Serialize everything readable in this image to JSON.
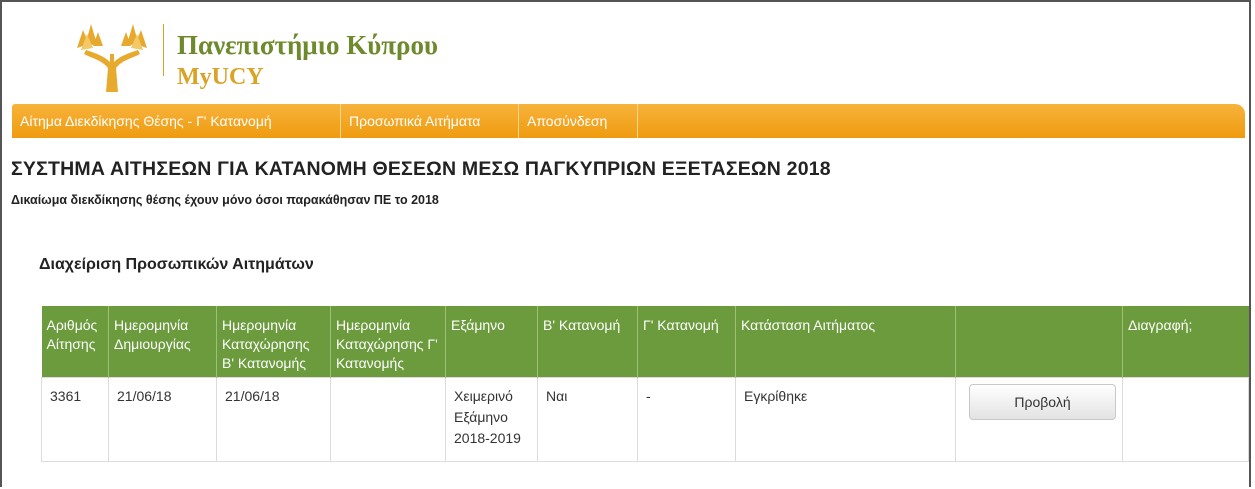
{
  "header": {
    "university_name": "Πανεπιστήμιο Κύπρου",
    "app_name": "MyUCY",
    "brand_colors": {
      "green": "#6f8a2c",
      "gold": "#d9a326"
    }
  },
  "nav": {
    "items": [
      {
        "label": "Αίτημα Διεκδίκησης Θέσης - Γ' Κατανομή"
      },
      {
        "label": "Προσωπικά Αιτήματα"
      },
      {
        "label": "Αποσύνδεση"
      }
    ],
    "color": "#f2a21c"
  },
  "page": {
    "title": "ΣΥΣΤΗΜΑ ΑΙΤΗΣΕΩΝ ΓΙΑ ΚΑΤΑΝΟΜΗ ΘΕΣΕΩΝ ΜΕΣΩ ΠΑΓΚΥΠΡΙΩΝ ΕΞΕΤΑΣΕΩΝ 2018",
    "subtitle": "Δικαίωμα διεκδίκησης θέσης έχουν μόνο όσοι παρακάθησαν ΠΕ το 2018",
    "section_title": "Διαχείριση Προσωπικών Αιτημάτων"
  },
  "table": {
    "header_color": "#6b9b3d",
    "columns": [
      "Αριθμός Αίτησης",
      "Ημερομηνία Δημιουργίας",
      "Ημερομηνία Καταχώρησης Β' Κατανομής",
      "Ημερομηνία Καταχώρησης Γ' Κατανομής",
      "Εξάμηνο",
      "Β' Κατανομή",
      "Γ' Κατανομή",
      "Κατάσταση Αιτήματος",
      "",
      "Διαγραφή;"
    ],
    "rows": [
      {
        "id": "3361",
        "created": "21/06/18",
        "b_registration": "21/06/18",
        "c_registration": "",
        "semester": "Χειμερινό Εξάμηνο 2018-2019",
        "b_allocation": "Ναι",
        "c_allocation": "-",
        "status": "Εγκρίθηκε",
        "action_label": "Προβολή",
        "delete": ""
      }
    ]
  }
}
